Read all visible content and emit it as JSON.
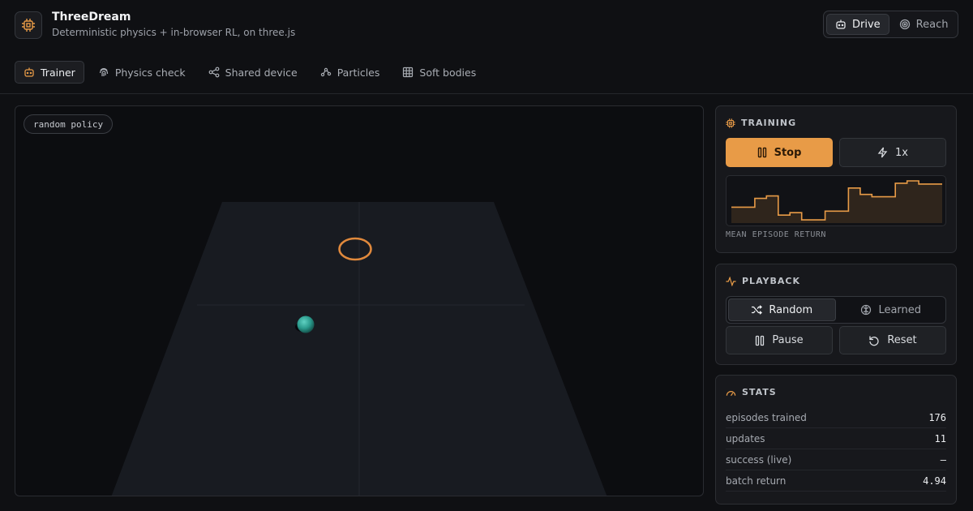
{
  "app": {
    "title": "ThreeDream",
    "subtitle": "Deterministic physics + in-browser RL, on three.js"
  },
  "header": {
    "modes": [
      {
        "label": "Drive",
        "icon": "robot-icon",
        "active": true
      },
      {
        "label": "Reach",
        "icon": "target-icon",
        "active": false
      }
    ]
  },
  "tabs": [
    {
      "label": "Trainer",
      "icon": "robot-icon",
      "active": true
    },
    {
      "label": "Physics check",
      "icon": "fingerprint-icon",
      "active": false
    },
    {
      "label": "Shared device",
      "icon": "share-icon",
      "active": false
    },
    {
      "label": "Particles",
      "icon": "particles-icon",
      "active": false
    },
    {
      "label": "Soft bodies",
      "icon": "grid-icon",
      "active": false
    }
  ],
  "viewport": {
    "policy_badge": "random policy"
  },
  "training": {
    "title": "TRAINING",
    "stop_label": "Stop",
    "speed_label": "1x",
    "sparkline_caption": "MEAN EPISODE RETURN",
    "accent": "#e89b47",
    "return_series": [
      2.0,
      2.0,
      3.1,
      3.4,
      1.0,
      1.3,
      0.4,
      0.4,
      1.5,
      1.5,
      4.4,
      3.6,
      3.3,
      3.3,
      5.0,
      5.3,
      4.9,
      4.9
    ]
  },
  "playback": {
    "title": "PLAYBACK",
    "options": [
      {
        "label": "Random",
        "icon": "shuffle-icon",
        "active": true
      },
      {
        "label": "Learned",
        "icon": "brain-icon",
        "active": false
      }
    ],
    "pause_label": "Pause",
    "reset_label": "Reset"
  },
  "stats": {
    "title": "STATS",
    "rows": [
      {
        "label": "episodes trained",
        "value": "176"
      },
      {
        "label": "updates",
        "value": "11"
      },
      {
        "label": "success (live)",
        "value": "–"
      },
      {
        "label": "batch return",
        "value": "4.94"
      }
    ]
  }
}
